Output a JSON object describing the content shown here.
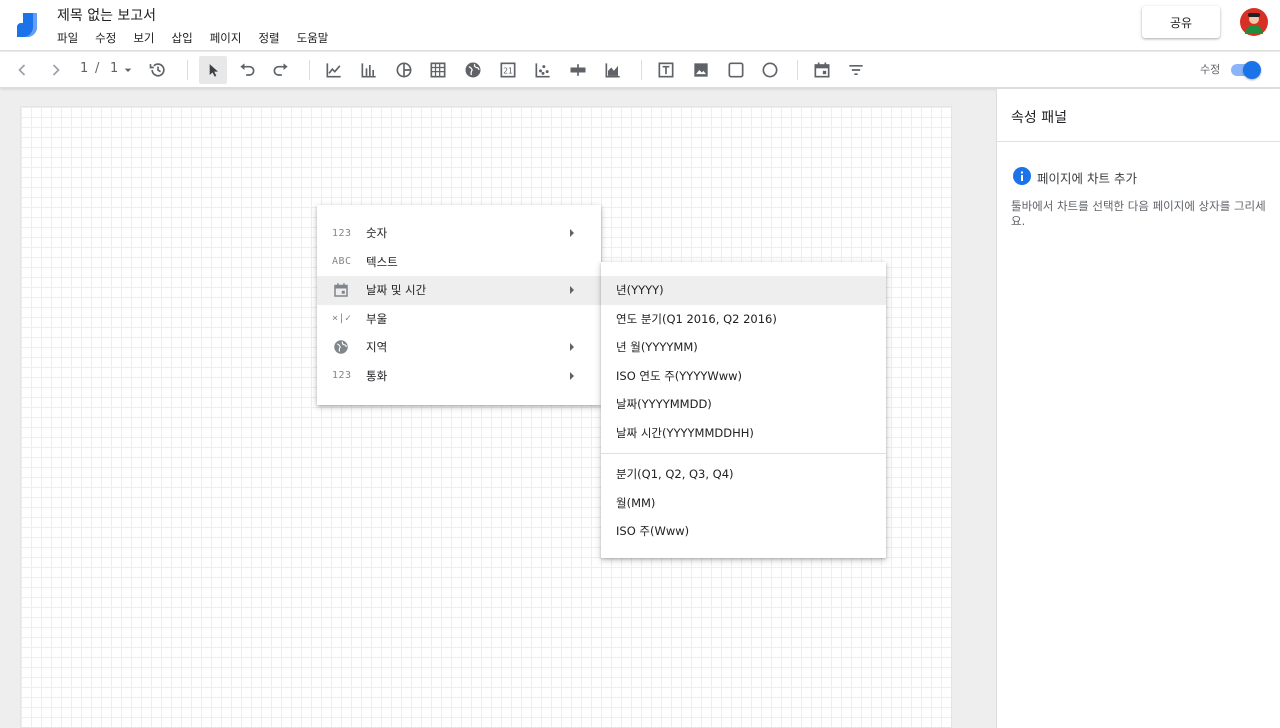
{
  "header": {
    "doc_title": "제목 없는 보고서",
    "menus": [
      "파일",
      "수정",
      "보기",
      "삽입",
      "페이지",
      "정렬",
      "도움말"
    ],
    "share_label": "공유"
  },
  "toolbar": {
    "page_current": "1",
    "page_sep": "/",
    "page_total": "1",
    "edit_label": "수정",
    "edit_mode_on": true
  },
  "panel": {
    "title": "속성 패널",
    "heading": "페이지에 차트 추가",
    "description": "툴바에서 차트를 선택한 다음 페이지에 상자를 그리세요."
  },
  "type_menu": {
    "items": [
      {
        "icon_text": "123",
        "label": "숫자",
        "submenu": true
      },
      {
        "icon_text": "ABC",
        "label": "텍스트",
        "submenu": false
      },
      {
        "icon": "calendar-icon",
        "label": "날짜 및 시간",
        "submenu": true,
        "highlighted": true
      },
      {
        "icon_text": "×|✓",
        "label": "부울",
        "submenu": false
      },
      {
        "icon": "globe-icon",
        "label": "지역",
        "submenu": true
      },
      {
        "icon_text": "123",
        "label": "통화",
        "submenu": true
      }
    ]
  },
  "date_submenu": {
    "group1": [
      "년(YYYY)",
      "연도 분기(Q1 2016, Q2 2016)",
      "년 월(YYYYMM)",
      "ISO 연도 주(YYYYWww)",
      "날짜(YYYYMMDD)",
      "날짜 시간(YYYYMMDDHH)"
    ],
    "group2": [
      "분기(Q1, Q2, Q3, Q4)",
      "월(MM)",
      "ISO 주(Www)"
    ]
  },
  "colors": {
    "accent": "#1a73e8",
    "menu_highlight": "#eeeeee"
  }
}
